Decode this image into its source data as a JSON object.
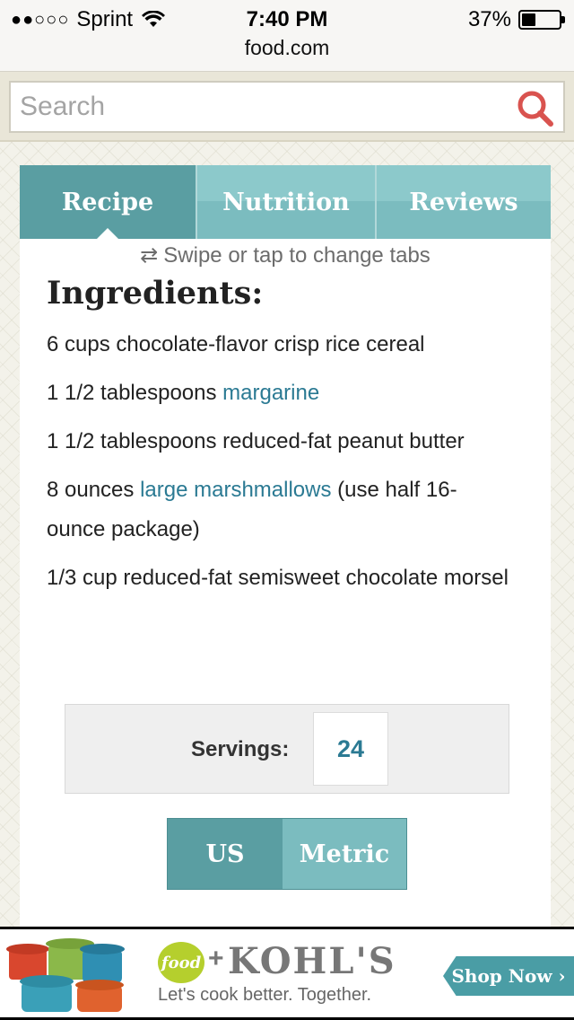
{
  "status_bar": {
    "signal_dots": "●●○○○",
    "carrier": "Sprint",
    "time": "7:40 PM",
    "battery_percent": "37%",
    "battery_level": 0.37,
    "url": "food.com"
  },
  "search": {
    "placeholder": "Search",
    "icon": "search-icon"
  },
  "tabs": [
    {
      "label": "Recipe",
      "active": true
    },
    {
      "label": "Nutrition",
      "active": false
    },
    {
      "label": "Reviews",
      "active": false
    }
  ],
  "swipe_hint": "Swipe or tap to change tabs",
  "ingredients": {
    "title": "Ingredients:",
    "items": [
      {
        "before": "6 cups chocolate-flavor crisp rice cereal",
        "link": "",
        "after": ""
      },
      {
        "before": "1 1/2 tablespoons ",
        "link": "margarine",
        "after": ""
      },
      {
        "before": "1 1/2 tablespoons reduced-fat peanut butter",
        "link": "",
        "after": ""
      },
      {
        "before": "8 ounces ",
        "link": "large marshmallows",
        "after": " (use half 16-ounce package)"
      },
      {
        "before": "1/3 cup reduced-fat semisweet chocolate morsel",
        "link": "",
        "after": ""
      }
    ]
  },
  "servings": {
    "label": "Servings:",
    "value": "24"
  },
  "units": {
    "us": "US",
    "metric": "Metric",
    "selected": "US"
  },
  "ad": {
    "food_logo": "food",
    "plus": "+",
    "brand": "KOHL'S",
    "tagline": "Let's cook better. Together.",
    "cta": "Shop Now ›"
  },
  "colors": {
    "accent_dark": "#5a9ea2",
    "accent_light": "#7bbcbf",
    "link": "#2b7a93",
    "search_icon": "#d9534f"
  }
}
